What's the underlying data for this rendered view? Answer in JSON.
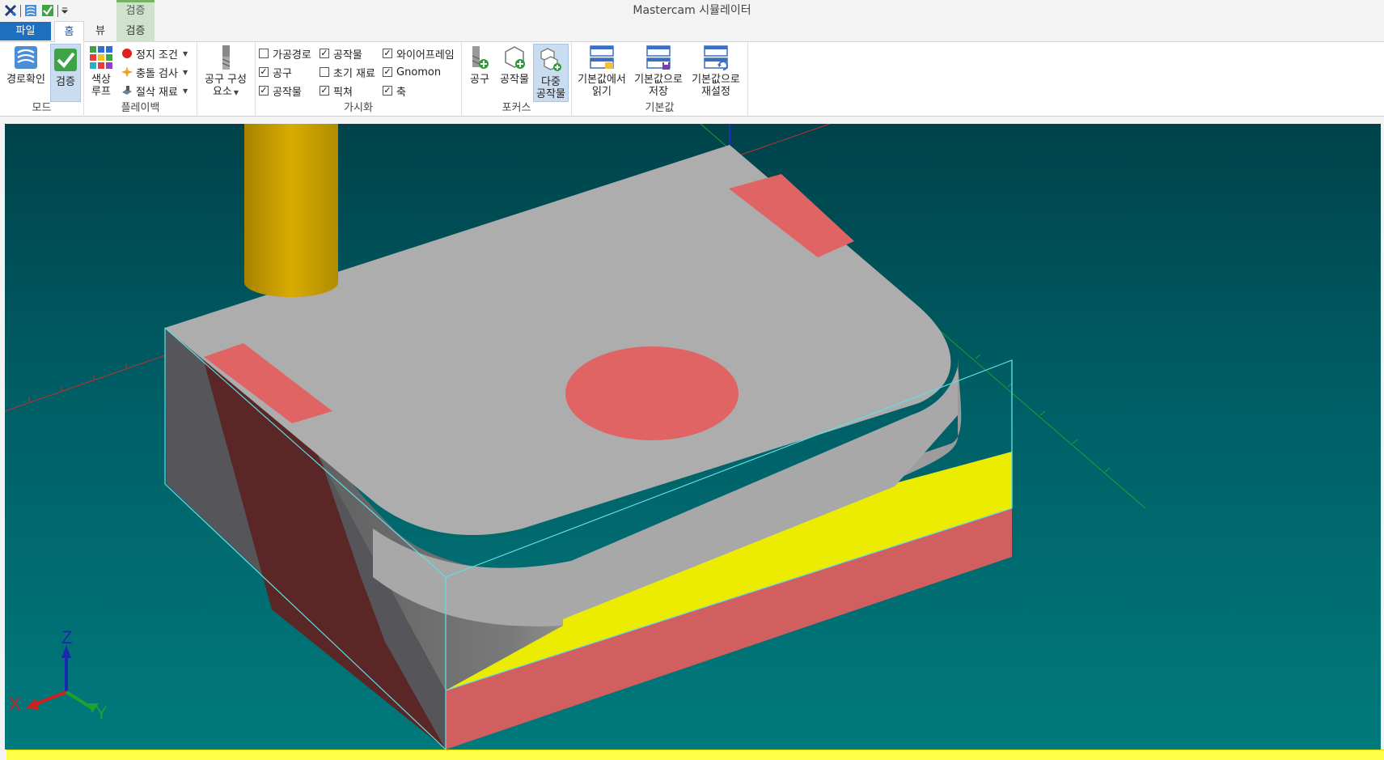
{
  "window": {
    "title": "Mastercam 시뮬레이터"
  },
  "quick_access": {
    "icons": [
      "mastercam-logo-icon",
      "backplot-icon",
      "verify-icon",
      "customize-qat-icon"
    ]
  },
  "context_tab": {
    "label": "검증"
  },
  "tabs": [
    {
      "label": "파일"
    },
    {
      "label": "홈"
    },
    {
      "label": "뷰"
    },
    {
      "label": "검증"
    }
  ],
  "ribbon": {
    "mode": {
      "label": "모드",
      "backplot": "경로확인",
      "verify": "검증"
    },
    "playback": {
      "label": "플레이백",
      "color_loop_line1": "색상",
      "color_loop_line2": "루프",
      "stop_conditions": "정지 조건",
      "collision_check": "충돌 검사",
      "cut_stock": "절삭 재료"
    },
    "tool_components": {
      "line1": "공구 구성",
      "line2": "요소"
    },
    "visibility": {
      "label": "가시화",
      "items": [
        {
          "label": "가공경로",
          "checked": false
        },
        {
          "label": "공구",
          "checked": true
        },
        {
          "label": "공작물",
          "checked": true
        },
        {
          "label": "공작물",
          "checked": true
        },
        {
          "label": "초기 재료",
          "checked": false
        },
        {
          "label": "픽쳐",
          "checked": true
        },
        {
          "label": "와이어프레임",
          "checked": true
        },
        {
          "label": "Gnomon",
          "checked": true
        },
        {
          "label": "축",
          "checked": true
        }
      ]
    },
    "focus": {
      "label": "포커스",
      "tool": "공구",
      "workpiece": "공작물",
      "multi_line1": "다중",
      "multi_line2": "공작물"
    },
    "defaults": {
      "label": "기본값",
      "read_line1": "기본값에서",
      "read_line2": "읽기",
      "save_line1": "기본값으로",
      "save_line2": "저장",
      "reset_line1": "기본값으로",
      "reset_line2": "재설정"
    }
  },
  "gnomon": {
    "x": "X",
    "y": "Y",
    "z": "Z"
  },
  "colors": {
    "viewport_top": "#00424a",
    "viewport_bottom": "#007a7c",
    "stock_top": "#adadad",
    "cut_region": "#e06464",
    "fixture": "#ecec00",
    "tool": "#d4a800",
    "wireframe": "#5fe0e6",
    "status": "#ffff4a"
  }
}
